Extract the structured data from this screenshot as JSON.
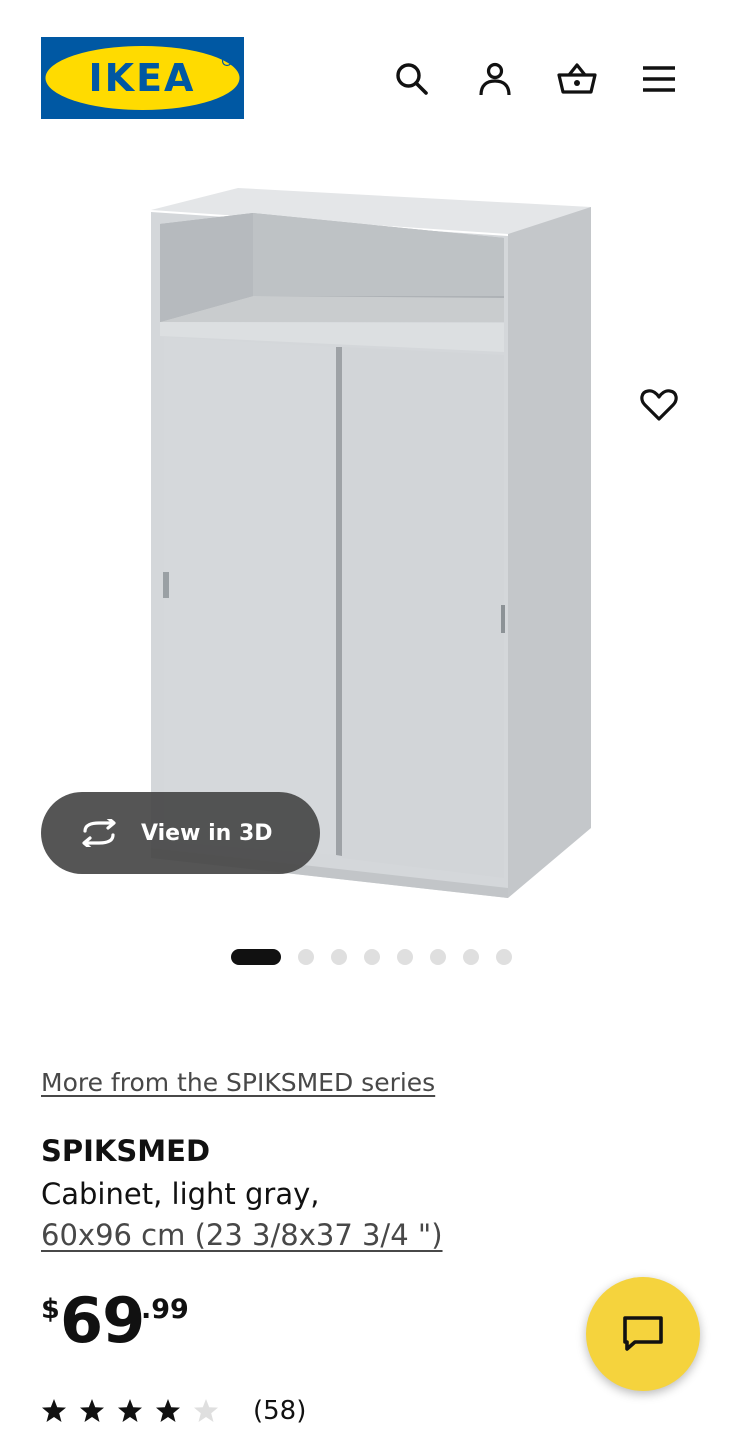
{
  "header": {
    "logo_text": "IKEA",
    "icons": [
      "search-icon",
      "account-icon",
      "basket-icon",
      "menu-icon"
    ]
  },
  "gallery": {
    "view_3d_label": "View in 3D",
    "total_images": 8,
    "active_index": 0
  },
  "product": {
    "series_link": "More from the SPIKSMED series",
    "name": "SPIKSMED",
    "description": "Cabinet, light gray,",
    "size": "60x96 cm (23 3/8x37 3/4 \")",
    "price": {
      "currency": "$",
      "integer": "69",
      "decimal": ".99"
    },
    "rating": {
      "value": 4,
      "max": 5,
      "count_label": "(58)"
    }
  },
  "colors": {
    "ikea_blue": "#0058a3",
    "ikea_yellow": "#ffdb00",
    "chat_yellow": "#f5d33d"
  }
}
